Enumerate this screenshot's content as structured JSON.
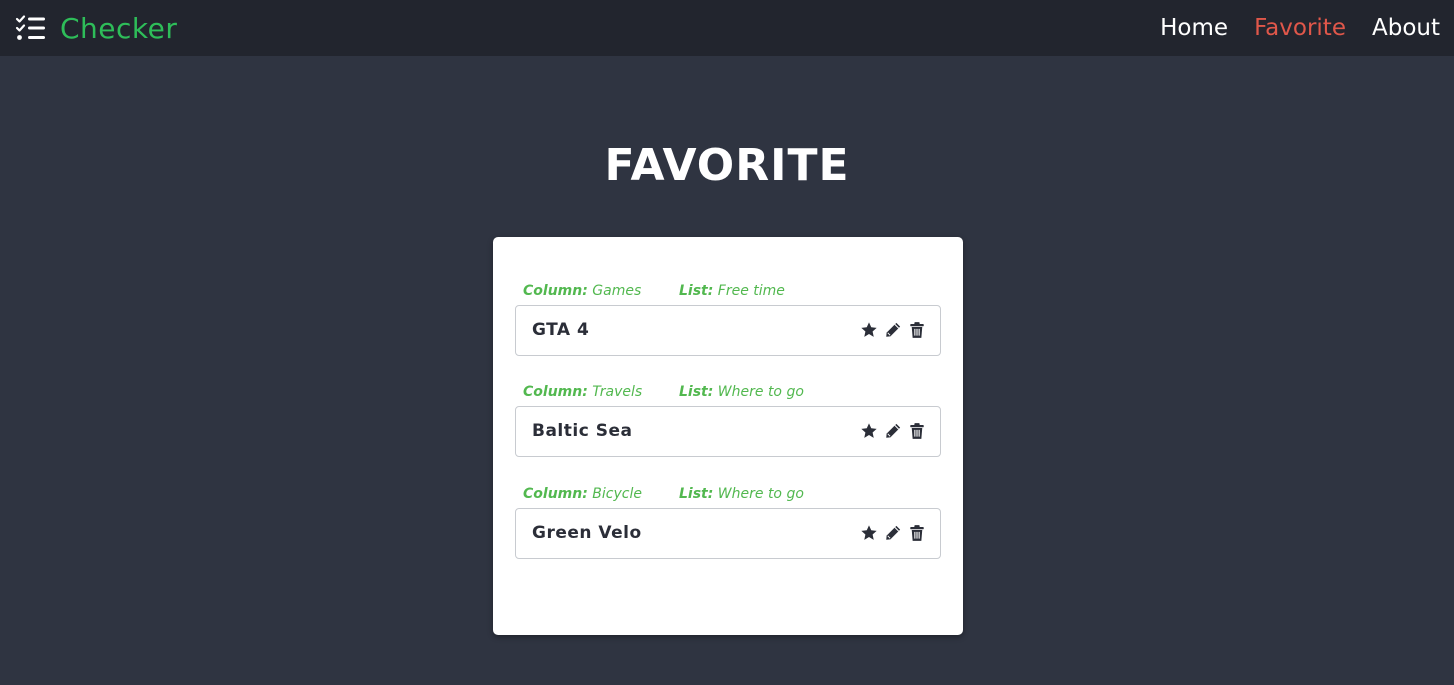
{
  "nav": {
    "brand_icon": "checklist-icon",
    "brand": "Checker",
    "links": [
      {
        "label": "Home",
        "active": false
      },
      {
        "label": "Favorite",
        "active": true
      },
      {
        "label": "About",
        "active": false
      }
    ]
  },
  "page": {
    "title": "FAVORITE"
  },
  "favorites": [
    {
      "column_label": "Column:",
      "column": "Games",
      "list_label": "List:",
      "list": "Free time",
      "title": "GTA 4"
    },
    {
      "column_label": "Column:",
      "column": "Travels",
      "list_label": "List:",
      "list": "Where to go",
      "title": "Baltic Sea"
    },
    {
      "column_label": "Column:",
      "column": "Bicycle",
      "list_label": "List:",
      "list": "Where to go",
      "title": "Green Velo"
    }
  ],
  "icons": {
    "favorite": "star-icon",
    "edit": "pencil-icon",
    "delete": "trash-icon"
  },
  "colors": {
    "background": "#2f3441",
    "navbar": "#22252e",
    "brand": "#2ebd59",
    "active_link": "#e0574a",
    "meta": "#52b84f",
    "item_text": "#2b2e38"
  }
}
